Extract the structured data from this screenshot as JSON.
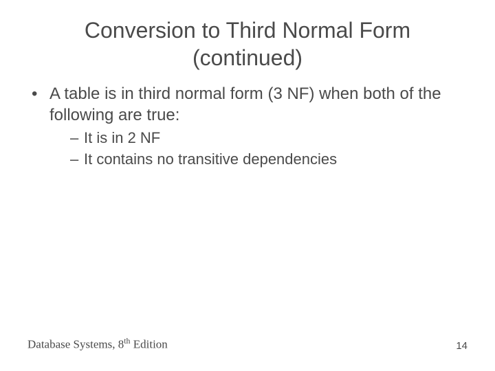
{
  "title_line1": "Conversion to Third Normal Form",
  "title_line2": "(continued)",
  "bullet1": "A table is in third normal form (3 NF) when both of the following are true:",
  "sub1": "It is in 2 NF",
  "sub2": "It contains no transitive dependencies",
  "footer_prefix": "Database Systems, 8",
  "footer_sup": "th",
  "footer_suffix": " Edition",
  "page_number": "14"
}
